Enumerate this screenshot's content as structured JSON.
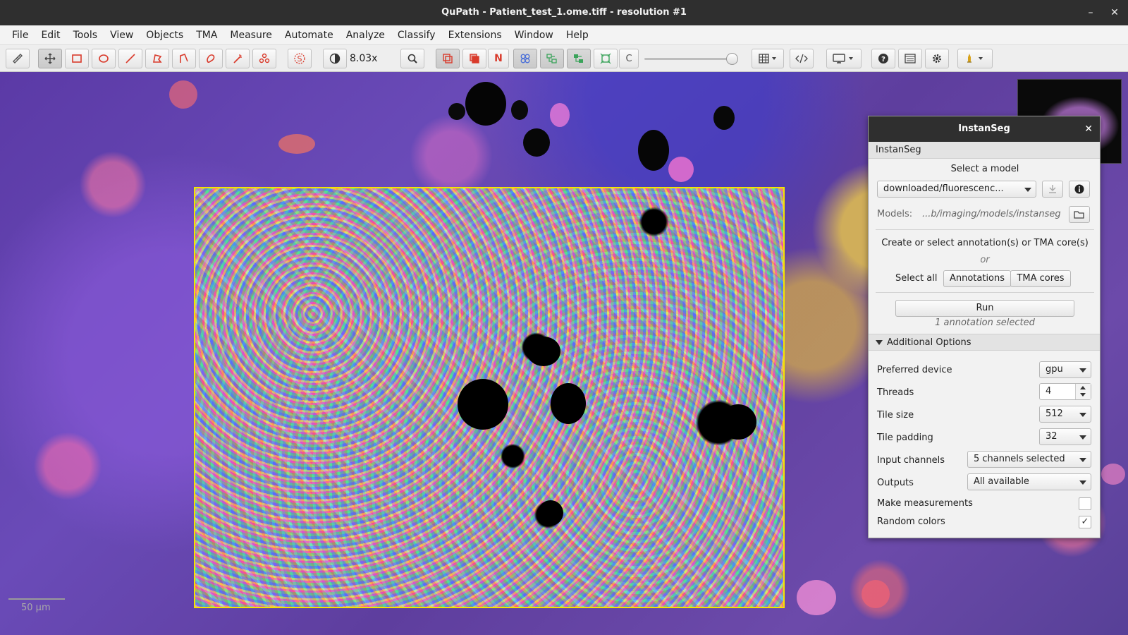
{
  "window": {
    "title": "QuPath - Patient_test_1.ome.tiff - resolution #1",
    "minimize_icon": "minimize-icon",
    "close_icon": "close-icon"
  },
  "menu": [
    "File",
    "Edit",
    "Tools",
    "View",
    "Objects",
    "TMA",
    "Measure",
    "Automate",
    "Analyze",
    "Classify",
    "Extensions",
    "Window",
    "Help"
  ],
  "toolbar": {
    "zoom": "8.03x",
    "icons": [
      "ruler-icon",
      "move-icon",
      "rectangle-icon",
      "ellipse-icon",
      "line-icon",
      "polygon-icon",
      "polyline-icon",
      "brush-icon",
      "wand-icon",
      "points-icon",
      "selection-mode-icon",
      "brightness-contrast-icon",
      "zoom-to-fit-icon",
      "show-annotations-icon",
      "fill-annotations-icon",
      "show-names-icon",
      "show-tma-grid-icon",
      "show-detections-icon",
      "fill-detections-icon",
      "show-pixel-classification-icon",
      "show-cell-boundaries-icon",
      "opacity-slider",
      "grid-icon",
      "script-editor-icon",
      "display-icon",
      "help-icon",
      "log-icon",
      "preferences-icon",
      "extensions-icon"
    ],
    "measure_mode_letter": "N",
    "channel_letter": "C",
    "accent": "#d93a2b"
  },
  "viewer": {
    "scale_bar": "50 µm",
    "roi_color": "#f5e400"
  },
  "instanseg": {
    "dialog_title": "InstanSeg",
    "section_title": "InstanSeg",
    "select_model_label": "Select a model",
    "model_value": "downloaded/fluorescenc...",
    "models_label": "Models:",
    "models_path": "...b/imaging/models/instanseg",
    "create_select_text": "Create or select annotation(s) or TMA core(s)",
    "or_text": "or",
    "select_all_label": "Select all",
    "annotations_button": "Annotations",
    "tma_cores_button": "TMA cores",
    "run_button": "Run",
    "status": "1 annotation selected",
    "additional_options": "Additional Options",
    "options": {
      "preferred_device": {
        "label": "Preferred device",
        "value": "gpu"
      },
      "threads": {
        "label": "Threads",
        "value": "4"
      },
      "tile_size": {
        "label": "Tile size",
        "value": "512"
      },
      "tile_padding": {
        "label": "Tile padding",
        "value": "32"
      },
      "input_channels": {
        "label": "Input channels",
        "value": "5 channels selected"
      },
      "outputs": {
        "label": "Outputs",
        "value": "All available"
      },
      "make_measurements": {
        "label": "Make measurements",
        "checked": false
      },
      "random_colors": {
        "label": "Random colors",
        "checked": true,
        "mark": "✓"
      }
    }
  }
}
